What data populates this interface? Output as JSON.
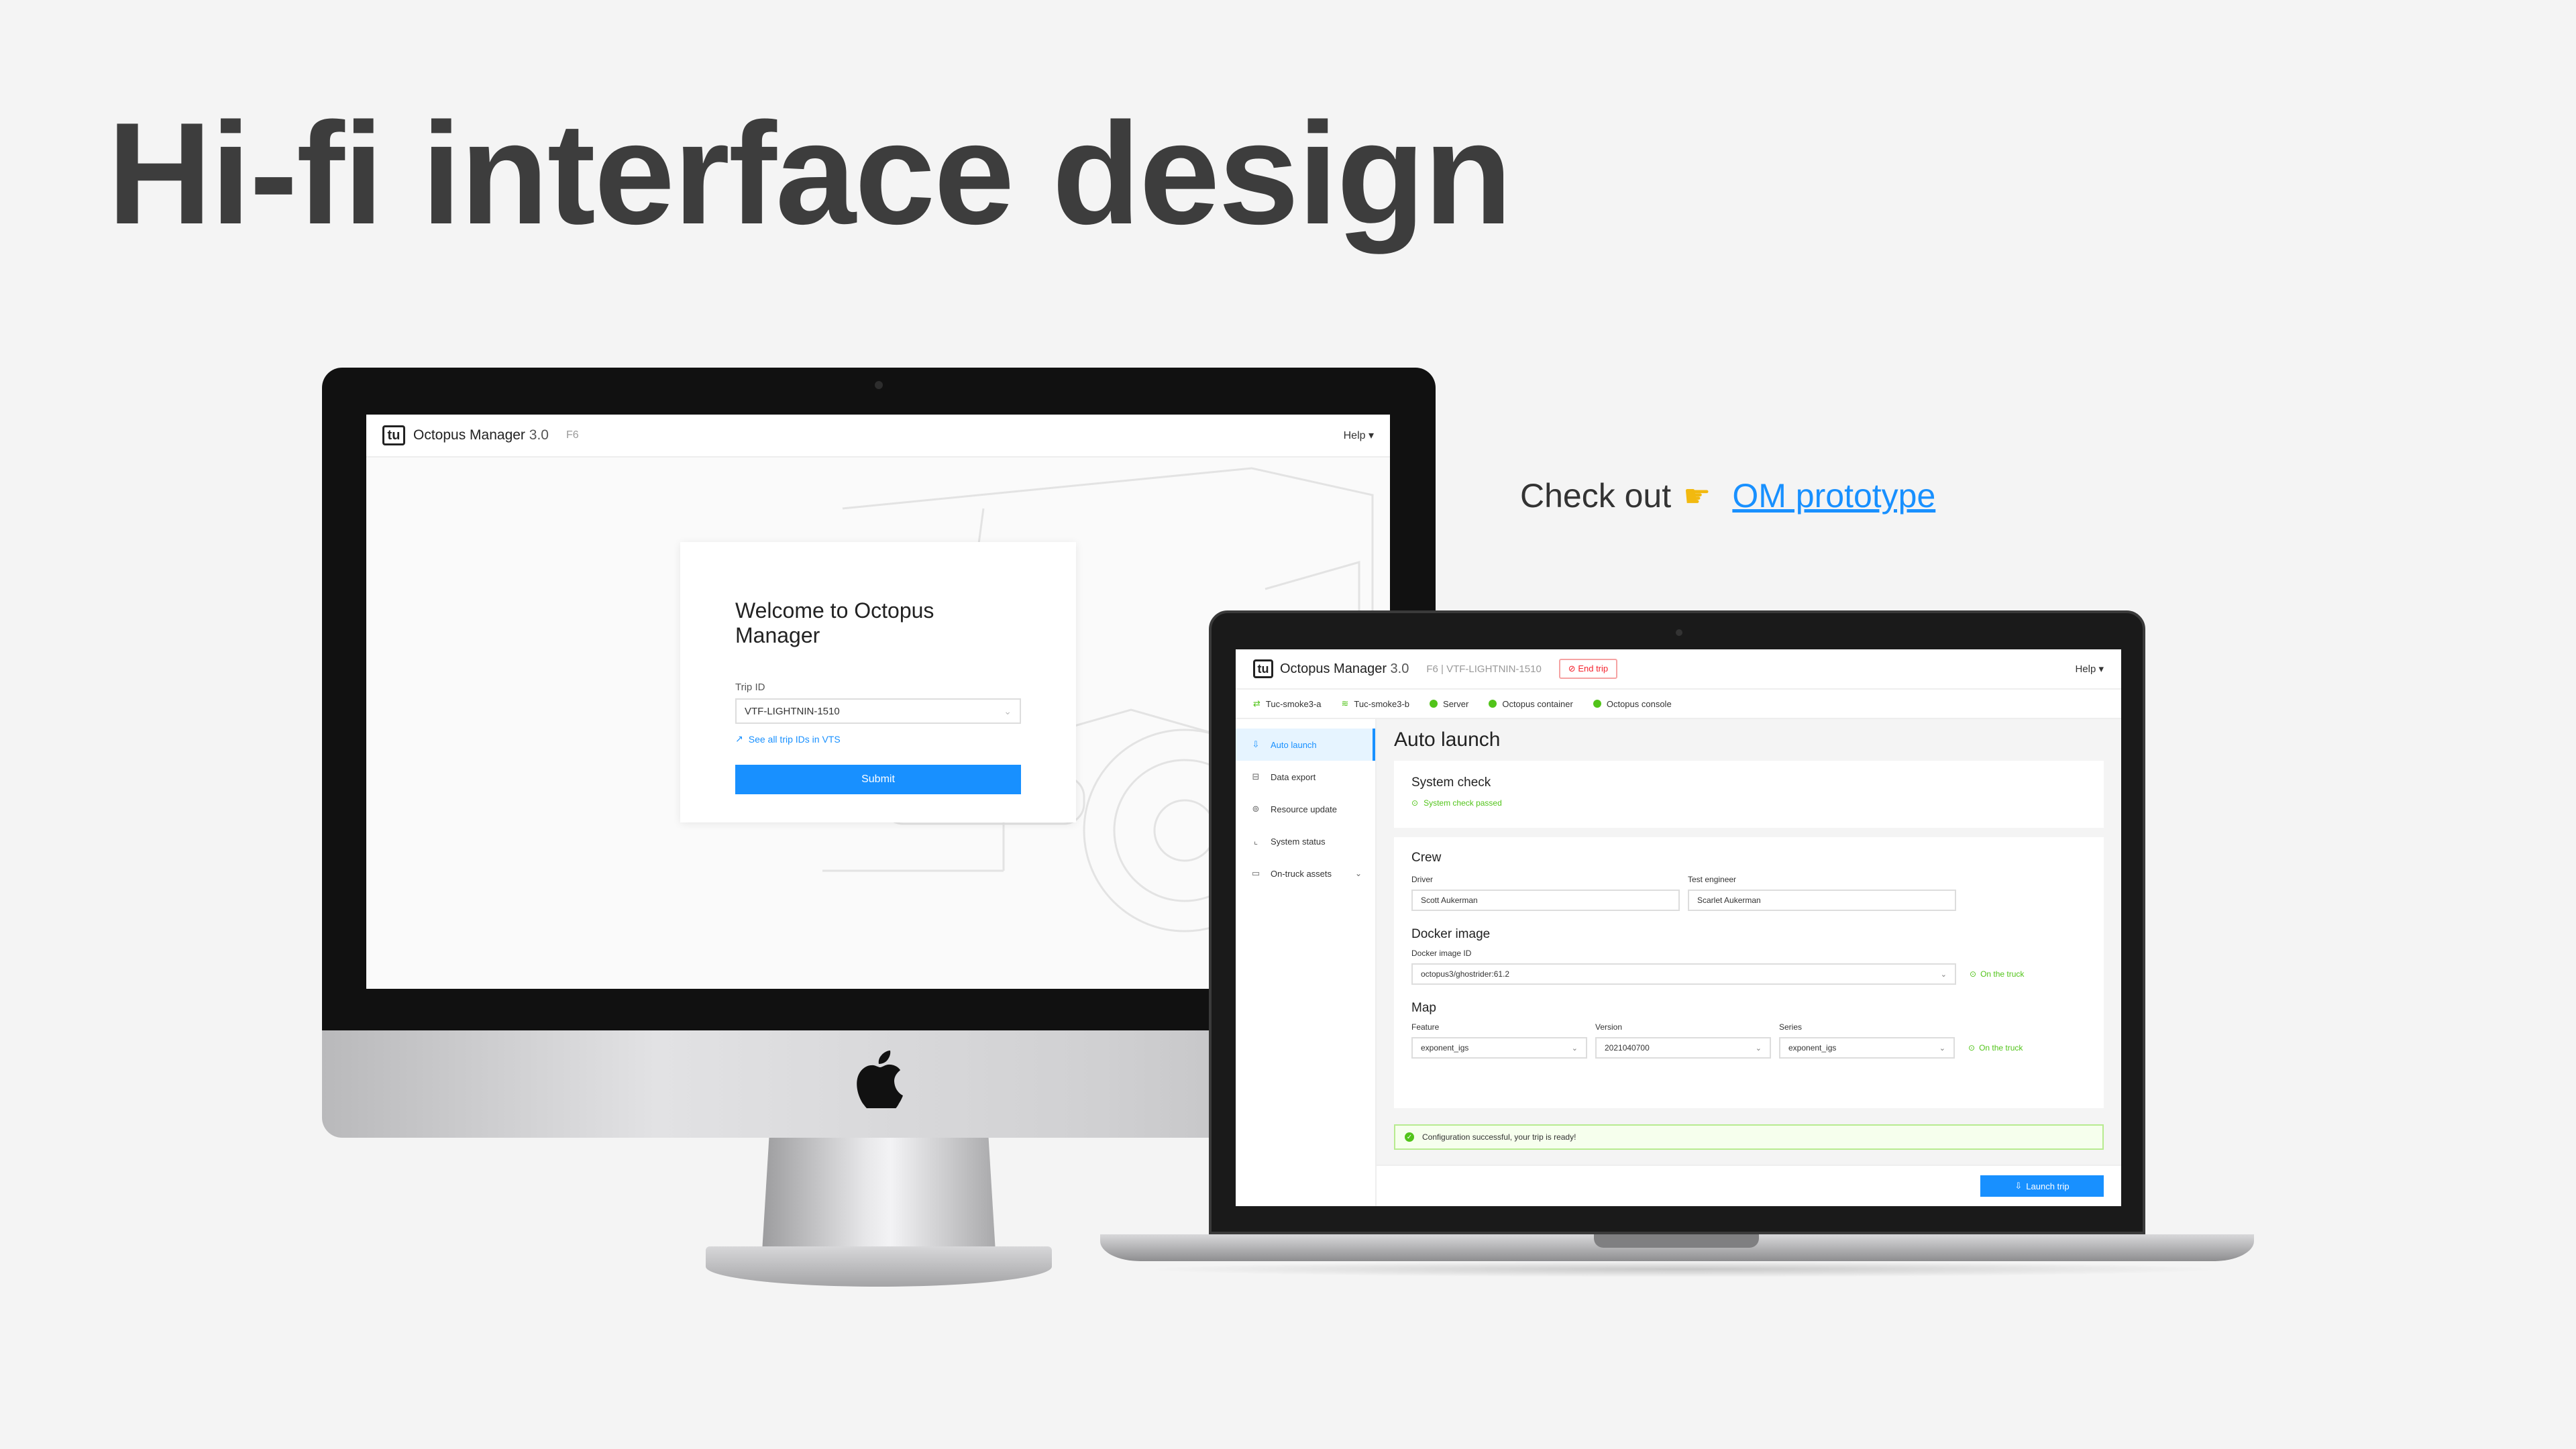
{
  "page": {
    "title": "Hi-fi interface design",
    "cta_text": "Check out",
    "cta_link": "OM prototype"
  },
  "app": {
    "logo": "tu",
    "name": "Octopus Manager",
    "version": "3.0",
    "help": "Help"
  },
  "login": {
    "subtitle": "F6",
    "heading": "Welcome to Octopus Manager",
    "trip_label": "Trip ID",
    "trip_value": "VTF-LIGHTNIN-1510",
    "link": "See all trip IDs in VTS",
    "submit": "Submit"
  },
  "launch": {
    "subtitle": "F6 | VTF-LIGHTNIN-1510",
    "end_trip": "End trip",
    "status": [
      "Tuc-smoke3-a",
      "Tuc-smoke3-b",
      "Server",
      "Octopus container",
      "Octopus console"
    ],
    "sidebar": [
      "Auto launch",
      "Data export",
      "Resource update",
      "System status",
      "On-truck assets"
    ],
    "page_title": "Auto launch",
    "system_check": {
      "title": "System check",
      "status": "System check passed"
    },
    "crew": {
      "title": "Crew",
      "driver_label": "Driver",
      "driver": "Scott Aukerman",
      "engineer_label": "Test engineer",
      "engineer": "Scarlet Aukerman"
    },
    "docker": {
      "title": "Docker image",
      "label": "Docker image ID",
      "value": "octopus3/ghostrider:61.2",
      "on_truck": "On the truck"
    },
    "map": {
      "title": "Map",
      "feature_label": "Feature",
      "feature": "exponent_igs",
      "version_label": "Version",
      "version": "2021040700",
      "series_label": "Series",
      "series": "exponent_igs",
      "on_truck": "On the truck"
    },
    "alert": "Configuration successful, your trip is ready!",
    "launch_button": "Launch trip"
  },
  "colors": {
    "primary": "#1890ff",
    "success": "#52c41a",
    "danger": "#f5222d"
  }
}
